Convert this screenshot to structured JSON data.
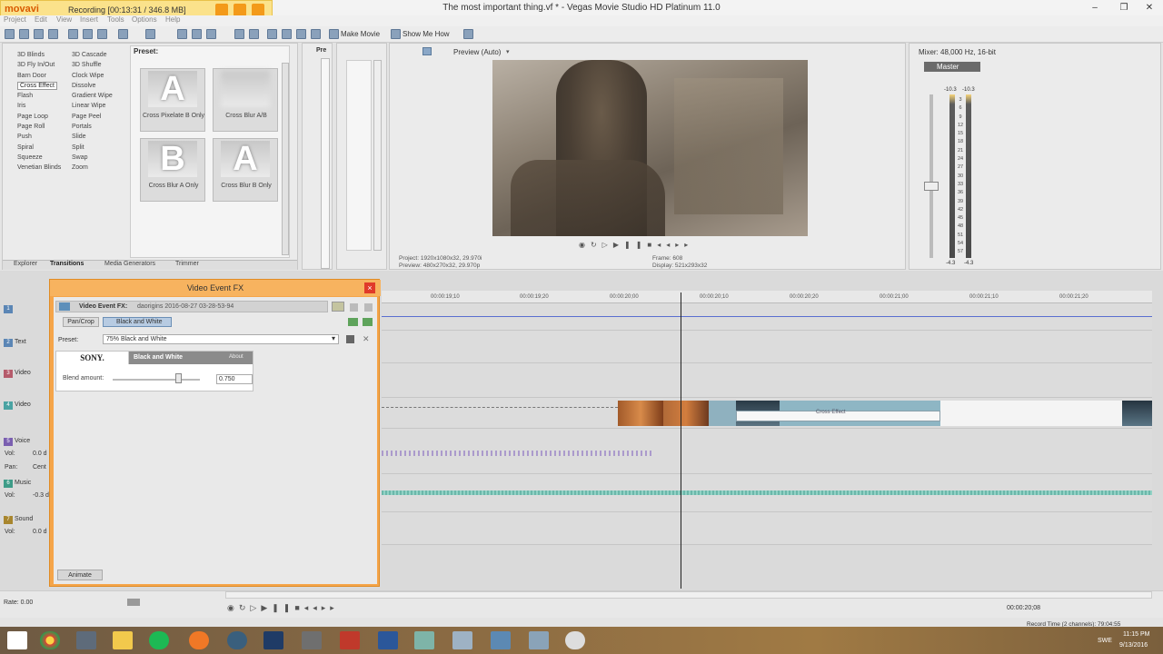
{
  "window": {
    "title": "The most important thing.vf * - Vegas Movie Studio HD Platinum 11.0"
  },
  "recording": {
    "brand": "movavi",
    "status": "Recording [00:13:31 / 346.8 MB]"
  },
  "menu": [
    "Project",
    "Edit",
    "View",
    "Insert",
    "Tools",
    "Options",
    "Help"
  ],
  "toolbar": {
    "make_movie": "Make Movie",
    "show_me_how": "Show Me How"
  },
  "transitions": {
    "preset_label": "Preset:",
    "col1": [
      "3D Blinds",
      "3D Fly In/Out",
      "Barn Door",
      "Cross Effect",
      "Flash",
      "Iris",
      "Page Loop",
      "Page Roll",
      "Push",
      "Spiral",
      "Squeeze",
      "Venetian Blinds"
    ],
    "col2": [
      "3D Cascade",
      "3D Shuffle",
      "Clock Wipe",
      "Dissolve",
      "Gradient Wipe",
      "Linear Wipe",
      "Page Peel",
      "Portals",
      "Slide",
      "Split",
      "Swap",
      "Zoom"
    ],
    "selected": "Cross Effect",
    "presets": [
      {
        "glyph": "A",
        "caption": "Cross Pixelate B Only"
      },
      {
        "glyph": "",
        "caption": "Cross Blur A/B"
      },
      {
        "glyph": "B",
        "caption": "Cross Blur A Only"
      },
      {
        "glyph": "A",
        "caption": "Cross Blur B Only"
      }
    ],
    "tabs": [
      "Explorer",
      "Transitions",
      "Media Generators",
      "Trimmer"
    ]
  },
  "preview": {
    "mode": "Preview (Auto)",
    "project": "Project:   1920x1080x32, 29.970i",
    "preview_info": "Preview:   480x270x32, 29.970p",
    "frame": "Frame:      608",
    "display": "Display:    521x293x32"
  },
  "mixer": {
    "title": "Mixer: 48,000 Hz, 16-bit",
    "master": "Master",
    "peak_l": "-10.3",
    "peak_r": "-10.3",
    "scale": [
      "3",
      "6",
      "9",
      "12",
      "15",
      "18",
      "21",
      "24",
      "27",
      "30",
      "33",
      "36",
      "39",
      "42",
      "45",
      "48",
      "51",
      "54",
      "57"
    ],
    "level_l": "-4.3",
    "level_r": "-4.3"
  },
  "timeline": {
    "ticks": [
      "00:00:19;10",
      "00:00:19;20",
      "00:00:20;00",
      "00:00:20;10",
      "00:00:20;20",
      "00:00:21;00",
      "00:00:21;10",
      "00:00:21;20"
    ],
    "tracks": [
      {
        "num": "1",
        "name": ""
      },
      {
        "num": "2",
        "name": "Text"
      },
      {
        "num": "3",
        "name": "Video"
      },
      {
        "num": "4",
        "name": "Video"
      },
      {
        "num": "5",
        "name": "Voice"
      },
      {
        "num": "6",
        "name": "Music"
      },
      {
        "num": "7",
        "name": "Sound"
      }
    ],
    "vol_labels": [
      "Vol:",
      "Pan:",
      "Vol:",
      "Vol:"
    ],
    "vol_values": [
      "0.0 d",
      "Cent",
      "-0.3 d",
      "0.0 d"
    ],
    "transition_label": "Cross Effect",
    "rate": "Rate: 0.00"
  },
  "fx": {
    "title": "Video Event FX",
    "event_label": "Video Event FX:",
    "event_name": "daorigins 2016-08-27 03-28-53-94",
    "chain": [
      "Pan/Crop",
      "Black and White"
    ],
    "preset_label": "Preset:",
    "preset_value": "75% Black and White",
    "vendor": "SONY.",
    "plugin_name": "Black and White",
    "about": "About",
    "blend_label": "Blend amount:",
    "blend_value": "0.750",
    "animate": "Animate"
  },
  "status": {
    "timecode": "00:00:20;08",
    "record_time": "Record Time (2 channels): 79:04:55"
  },
  "taskbar": {
    "lang": "SWE",
    "time": "11:15 PM",
    "date": "9/13/2016"
  }
}
